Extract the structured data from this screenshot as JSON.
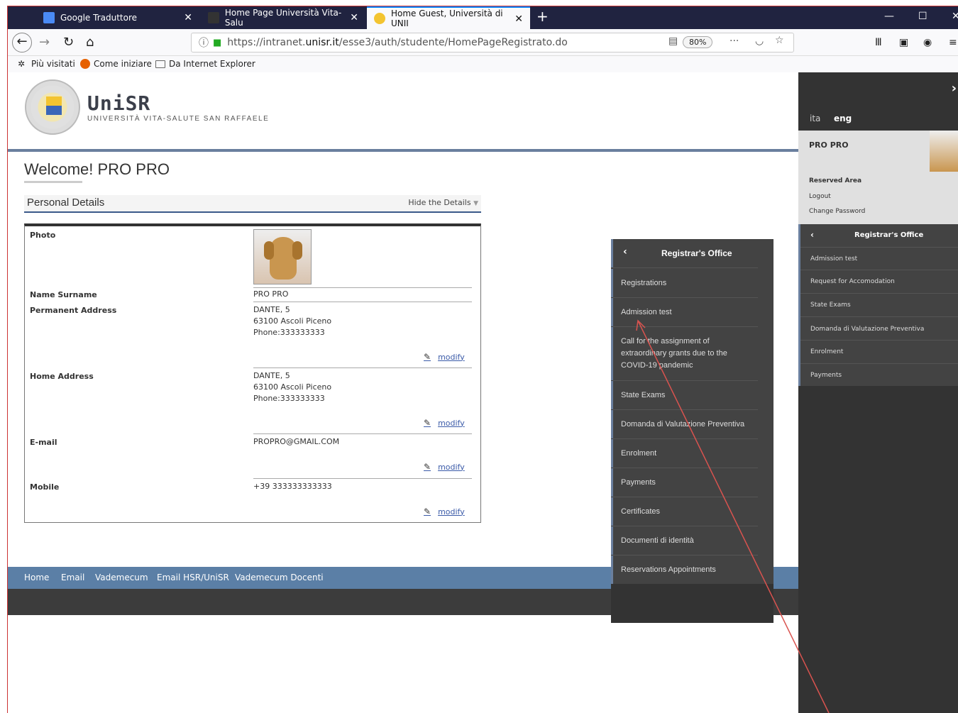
{
  "browser": {
    "tabs": [
      {
        "label": "Google Traduttore",
        "active": false
      },
      {
        "label": "Home Page Università Vita-Salu",
        "active": false
      },
      {
        "label": "Home Guest, Università di UNII",
        "active": true
      }
    ],
    "url_prefix": "https://intranet.",
    "url_host": "unisr.it",
    "url_path": "/esse3/auth/studente/HomePageRegistrato.do",
    "zoom": "80%",
    "bookmarks": [
      "Più visitati",
      "Come iniziare",
      "Da Internet Explorer"
    ],
    "accent": "#0a84ff"
  },
  "header": {
    "logo_big": "UniSR",
    "logo_small": "UNIVERSITÀ VITA-SALUTE SAN RAFFAELE"
  },
  "main": {
    "welcome": "Welcome! PRO PRO",
    "section_title": "Personal Details",
    "hide_label": "Hide the Details",
    "rows": {
      "photo_label": "Photo",
      "name_label": "Name Surname",
      "name_value": "PRO PRO",
      "perm_label": "Permanent Address",
      "perm_value": "DANTE, 5\n63100 Ascoli Piceno\nPhone:333333333",
      "home_label": "Home Address",
      "home_value": "DANTE, 5\n63100 Ascoli Piceno\nPhone:333333333",
      "email_label": "E-mail",
      "email_value": "PROPRO@GMAIL.COM",
      "mobile_label": "Mobile",
      "mobile_value": "+39 333333333333",
      "modify_label": "modify"
    }
  },
  "footer": {
    "links": [
      "Home",
      "Email",
      "Vademecum",
      "Email HSR/UniSR",
      "Vademecum Docenti"
    ]
  },
  "dropdown": {
    "title": "Registrar's Office",
    "items": [
      "Registrations",
      "Admission test",
      "Call for the assignment of\nextraordinary grants due to the\nCOVID-19 pandemic",
      "State Exams",
      "Domanda di Valutazione Preventiva",
      "Enrolment",
      "Payments",
      "Certificates",
      "Documenti di identità",
      "Reservations Appointments"
    ]
  },
  "sidebar": {
    "lang_ita": "ita",
    "lang_eng": "eng",
    "user_name": "PRO PRO",
    "reserved_area": "Reserved Area",
    "logout": "Logout",
    "change_password": "Change Password",
    "menu_title": "Registrar's Office",
    "menu_items": [
      "Admission test",
      "Request for Accomodation",
      "State Exams",
      "Domanda di Valutazione Preventiva",
      "Enrolment",
      "Payments"
    ],
    "annotation_color": "#d9534f"
  }
}
